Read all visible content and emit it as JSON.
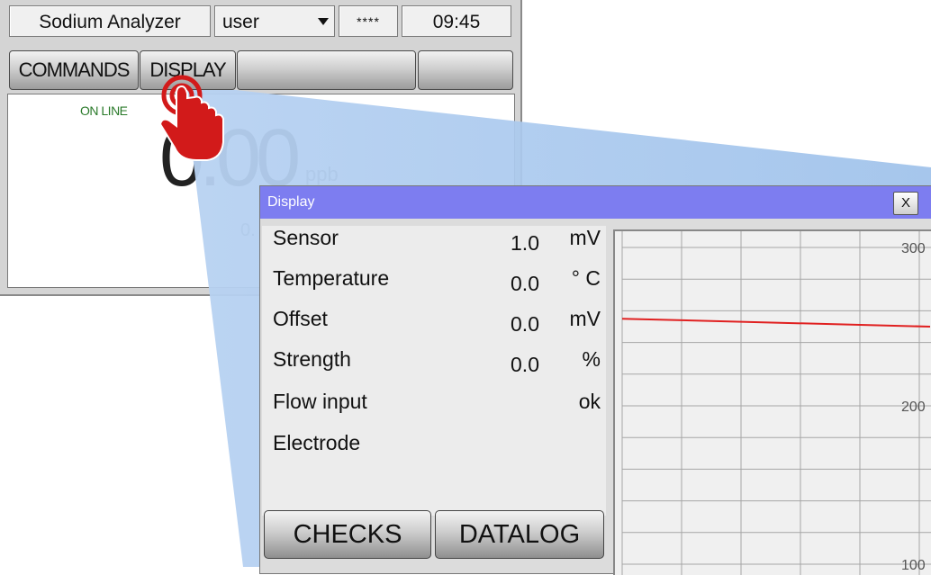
{
  "main": {
    "title": "Sodium Analyzer",
    "user_select": "user",
    "password_mask": "****",
    "clock": "09:45",
    "buttons": {
      "commands": "COMMANDS",
      "display": "DISPLAY",
      "blank1": "",
      "blank2": ""
    },
    "status": "ON LINE",
    "value": "0.00",
    "unit": "ppb",
    "secondary_value": "0."
  },
  "dialog": {
    "title": "Display",
    "close": "X",
    "readings": [
      {
        "label": "Sensor",
        "value": "1.0",
        "unit": "mV"
      },
      {
        "label": "Temperature",
        "value": "0.0",
        "unit": "° C"
      },
      {
        "label": "Offset",
        "value": "0.0",
        "unit": "mV"
      },
      {
        "label": "Strength",
        "value": "0.0",
        "unit": "%"
      },
      {
        "label": "Flow input",
        "value": "",
        "unit": "ok"
      },
      {
        "label": "Electrode",
        "value": "",
        "unit": ""
      }
    ],
    "buttons": {
      "checks": "CHECKS",
      "datalog": "DATALOG"
    }
  },
  "chart_data": {
    "type": "line",
    "y_ticks": [
      "300",
      "200",
      "100"
    ],
    "ylim": [
      100,
      300
    ],
    "x": [
      0,
      1
    ],
    "series": [
      {
        "values": [
          255,
          250
        ],
        "color": "#e02020"
      }
    ],
    "grid": true
  },
  "colors": {
    "titlebar": "#7d7df0",
    "online": "#2a7a2a",
    "trend": "#e02020",
    "beam": "#a8c8ee"
  },
  "icons": {
    "hand": "hand-pointer-icon",
    "dropdown": "dropdown-arrow-icon"
  }
}
